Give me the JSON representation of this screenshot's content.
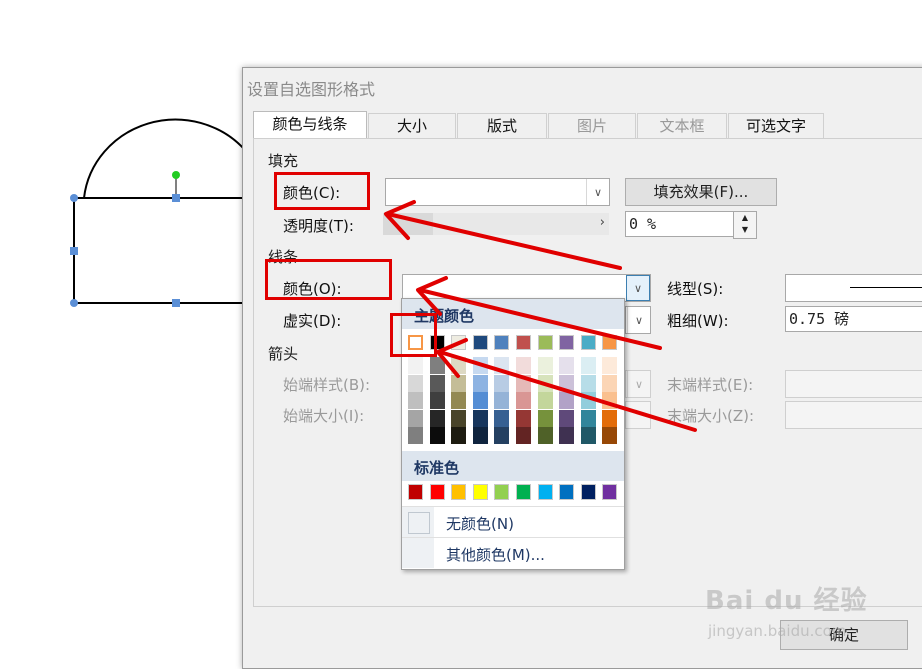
{
  "dialog": {
    "title": "设置自选图形格式",
    "tabs": [
      {
        "label": "颜色与线条",
        "state": "active"
      },
      {
        "label": "大小",
        "state": "normal"
      },
      {
        "label": "版式",
        "state": "normal"
      },
      {
        "label": "图片",
        "state": "disabled"
      },
      {
        "label": "文本框",
        "state": "disabled"
      },
      {
        "label": "可选文字",
        "state": "normal"
      }
    ],
    "fill": {
      "section": "填充",
      "color_label": "颜色(C):",
      "color_value": "",
      "effects_button": "填充效果(F)...",
      "transparency_label": "透明度(T):",
      "transparency_value": "0 %"
    },
    "line": {
      "section": "线条",
      "color_label": "颜色(O):",
      "dash_label": "虚实(D):",
      "style_label": "线型(S):",
      "weight_label": "粗细(W):",
      "weight_value": "0.75 磅"
    },
    "arrows": {
      "section": "箭头",
      "begin_style_label": "始端样式(B):",
      "begin_size_label": "始端大小(I):",
      "end_style_label": "末端样式(E):",
      "end_size_label": "末端大小(Z):"
    },
    "ok_button": "确定"
  },
  "color_popup": {
    "theme_header": "主题颜色",
    "theme_top_row": [
      "#ffffff",
      "#000000",
      "#eeece1",
      "#1f497d",
      "#4f81bd",
      "#c0504d",
      "#9bbb59",
      "#8064a2",
      "#4bacc6",
      "#f79646"
    ],
    "theme_shades": [
      [
        "#f2f2f2",
        "#d8d8d8",
        "#bfbfbf",
        "#a5a5a5",
        "#7f7f7f"
      ],
      [
        "#7f7f7f",
        "#595959",
        "#3f3f3f",
        "#262626",
        "#0c0c0c"
      ],
      [
        "#ddd9c3",
        "#c4bd97",
        "#938953",
        "#494429",
        "#1d1b10"
      ],
      [
        "#c6d9f0",
        "#8db3e2",
        "#548dd4",
        "#17365d",
        "#0f243e"
      ],
      [
        "#dbe5f1",
        "#b8cce4",
        "#95b3d7",
        "#366092",
        "#244061"
      ],
      [
        "#f2dcdb",
        "#e5b9b7",
        "#d99694",
        "#953734",
        "#632423"
      ],
      [
        "#ebf1dd",
        "#d7e3bc",
        "#c3d69b",
        "#76923c",
        "#4f6128"
      ],
      [
        "#e5e0ec",
        "#ccc1d9",
        "#b2a2c7",
        "#5f497a",
        "#3f3151"
      ],
      [
        "#dbeef3",
        "#b7dde8",
        "#92cddc",
        "#31859b",
        "#205867"
      ],
      [
        "#fdeada",
        "#fbd5b5",
        "#fac08f",
        "#e36c09",
        "#974806"
      ]
    ],
    "standard_header": "标准色",
    "standard_colors": [
      "#c00000",
      "#ff0000",
      "#ffc000",
      "#ffff00",
      "#92d050",
      "#00b050",
      "#00b0f0",
      "#0070c0",
      "#002060",
      "#7030a0"
    ],
    "no_color": "无颜色(N)",
    "more_colors": "其他颜色(M)...",
    "selected_swatch_color": "#f79646"
  },
  "annotation_color": "#e00000",
  "watermark": {
    "brand": "Bai du 经验",
    "site": "jingyan.baidu.com"
  }
}
